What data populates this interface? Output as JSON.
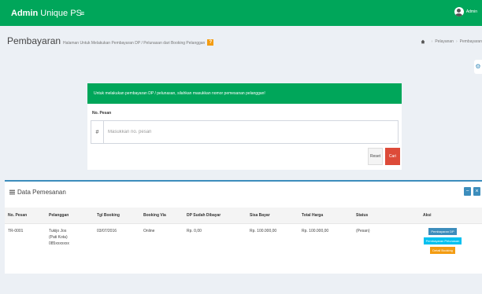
{
  "navbar": {
    "brand_bold": "Admin",
    "brand_rest": " Unique PS",
    "menu_icon": "hamburger-icon",
    "user_name": "Admin",
    "user_icon": "user-avatar-icon",
    "color": "#00a65a"
  },
  "header": {
    "title": "Pembayaran",
    "subtitle": "Halaman Untuk Melakukan Pembayaran DP / Pelunasan dari Booking Pelanggan",
    "help_icon": "help-icon",
    "breadcrumb": [
      "Pelayanan",
      "Pembayaran"
    ],
    "home_icon": "dashboard-icon"
  },
  "search": {
    "alert_text": "Untuk melakukan pembayaran DP / pelunasan, silahkan masukkan nomor pemesanan pelanggan!",
    "label": "No. Pesan",
    "placeholder": "Masukkan no. pesan",
    "value": "",
    "reset_label": "Reset",
    "cari_label": "Cari"
  },
  "table": {
    "title": "Data Pemesanan",
    "columns": [
      "No. Pesan",
      "Pelanggan",
      "Tgl Booking",
      "Booking Via",
      "DP Sudah Dibayar",
      "Sisa Bayar",
      "Total Harga",
      "Status",
      "Aksi"
    ],
    "rows": [
      {
        "no_pesan": "TR-0001",
        "pelanggan_1": "Tukijo Jos",
        "pelanggan_2": "(Pati Kota)",
        "pelanggan_3": "085xxxxxxx",
        "tgl_booking": "03/07/2016",
        "booking_via": "Online",
        "dp": "Rp. 0,00",
        "sisa": "Rp. 100.000,00",
        "total": "Rp. 100.000,00",
        "status": "(Pesan)",
        "actions": [
          "Pembayaran DP",
          "Pembayaran Pelunasan",
          "Detail Booking"
        ]
      }
    ]
  },
  "colors": {
    "primary": "#3c8dbc",
    "success": "#00a65a",
    "danger": "#dd4b39",
    "warning": "#f39c12",
    "info": "#00c0ef"
  }
}
